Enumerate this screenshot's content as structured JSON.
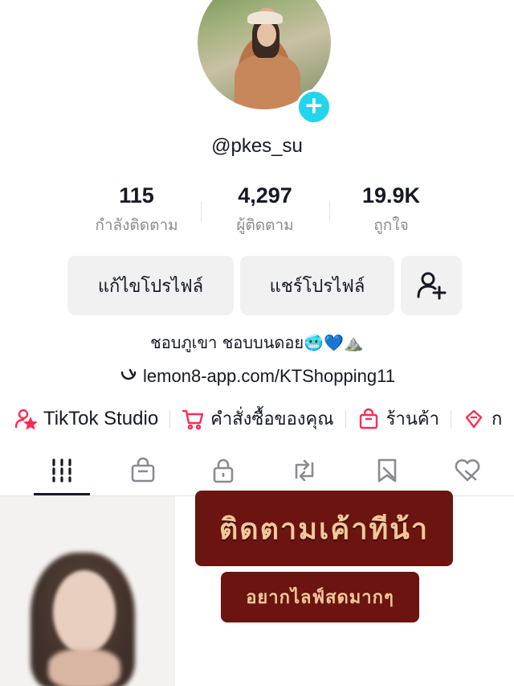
{
  "profile": {
    "username": "@pkes_su",
    "bio": "ชอบภูเขา ชอบบนดอย🥶💙⛰️",
    "link": "lemon8-app.com/KTShopping11"
  },
  "stats": [
    {
      "value": "115",
      "label": "กำลังติดตาม"
    },
    {
      "value": "4,297",
      "label": "ผู้ติดตาม"
    },
    {
      "value": "19.9K",
      "label": "ถูกใจ"
    }
  ],
  "buttons": {
    "edit_profile": "แก้ไขโปรไฟล์",
    "share_profile": "แชร์โปรไฟล์"
  },
  "shortcuts": [
    {
      "label": "TikTok Studio",
      "icon": "person-star-icon"
    },
    {
      "label": "คำสั่งซื้อของคุณ",
      "icon": "cart-icon"
    },
    {
      "label": "ร้านค้า",
      "icon": "shop-bag-icon"
    },
    {
      "label": "ก",
      "icon": "gift-icon"
    }
  ],
  "tabs": [
    {
      "icon": "grid-icon",
      "selected": true
    },
    {
      "icon": "shop-icon"
    },
    {
      "icon": "lock-icon"
    },
    {
      "icon": "repost-icon"
    },
    {
      "icon": "favorites-icon"
    },
    {
      "icon": "liked-icon"
    }
  ],
  "grid": {
    "banner_main": "ติดตามเค้าทีน้า",
    "banner_sub": "อยากไลฟ์สดมากๆ"
  },
  "colors": {
    "accent": "#fe2c55",
    "badge": "#20d5ec",
    "banner": "#6b1410"
  }
}
